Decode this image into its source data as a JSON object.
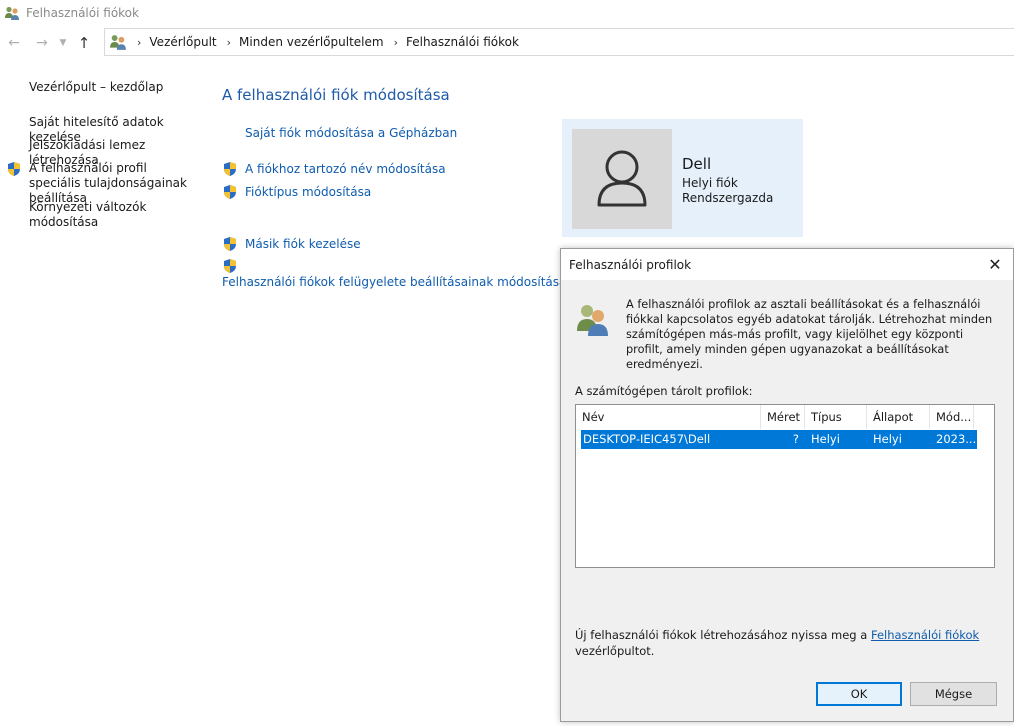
{
  "window": {
    "title": "Felhasználói fiókok"
  },
  "address": {
    "crumbs": [
      "Vezérlőpult",
      "Minden vezérlőpultelem",
      "Felhasználói fiókok"
    ]
  },
  "left_nav": {
    "home": "Vezérlőpult – kezdőlap",
    "items": [
      "Saját hitelesítő adatok kezelése",
      "Jelszókiadási lemez létrehozása",
      "A felhasználói profil speciális tulajdonságainak beállítása",
      "Környezeti változók módosítása"
    ]
  },
  "main": {
    "heading": "A felhasználói fiók módosítása",
    "links": [
      "Saját fiók módosítása a Gépházban",
      "A fiókhoz tartozó név módosítása",
      "Fióktípus módosítása",
      "Másik fiók kezelése",
      "Felhasználói fiókok felügyelete beállításainak módosítása"
    ]
  },
  "account": {
    "name": "Dell",
    "type": "Helyi fiók",
    "role": "Rendszergazda"
  },
  "dialog": {
    "title": "Felhasználói profilok",
    "description": "A felhasználói profilok az asztali beállításokat és a felhasználói fiókkal kapcsolatos egyéb adatokat tárolják. Létrehozhat minden számítógépen más-más profilt, vagy kijelölhet egy központi profilt, amely minden gépen ugyanazokat a beállításokat eredményezi.",
    "list_label": "A számítógépen tárolt profilok:",
    "columns": [
      "Név",
      "Méret",
      "Típus",
      "Állapot",
      "Mód..."
    ],
    "rows": [
      {
        "name": "DESKTOP-IEIC457\\Dell",
        "size": "?",
        "type": "Helyi",
        "status": "Helyi",
        "modified": "2023..."
      }
    ],
    "footer_prefix": "Új felhasználói fiókok létrehozásához nyissa meg a ",
    "footer_link": "Felhasználói fiókok",
    "footer_suffix": " vezérlőpultot.",
    "ok_label": "OK",
    "cancel_label": "Mégse"
  },
  "colors": {
    "link": "#0f5cad",
    "heading": "#1e5aa8",
    "selection": "#0078d7",
    "card_bg": "#e5f0fb"
  }
}
